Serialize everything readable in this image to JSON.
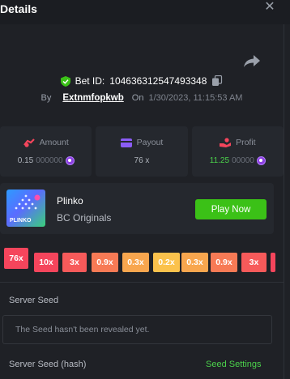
{
  "header": {
    "title": "Details"
  },
  "bet": {
    "label": "Bet ID:",
    "id": "104636312547493348"
  },
  "meta": {
    "by": "By",
    "user": "Extnmfopkwb",
    "on": "On",
    "date": "1/30/2023, 11:15:53 AM"
  },
  "stats": {
    "amount": {
      "label": "Amount",
      "value_main": "0.15",
      "value_dim": "000000"
    },
    "payout": {
      "label": "Payout",
      "value": "76 x"
    },
    "profit": {
      "label": "Profit",
      "value_main": "11.25",
      "value_dim": "00000"
    }
  },
  "game": {
    "name": "Plinko",
    "provider": "BC Originals",
    "play_label": "Play Now",
    "thumb_text": "PLINKO"
  },
  "multipliers": [
    "76x",
    "10x",
    "3x",
    "0.9x",
    "0.3x",
    "0.2x",
    "0.3x",
    "0.9x",
    "3x"
  ],
  "server_seed": {
    "label": "Server Seed",
    "message": "The Seed hasn't been revealed yet."
  },
  "server_seed_hash": {
    "label": "Server Seed (hash)",
    "settings": "Seed Settings"
  },
  "colors": {
    "accent_green": "#3bc117",
    "coin": "#8b3fe0",
    "multiplier_hot": "#f5455c",
    "multiplier_warm": "#f77a55",
    "multiplier_mild": "#f8a64e",
    "multiplier_cool": "#fbc24c"
  }
}
